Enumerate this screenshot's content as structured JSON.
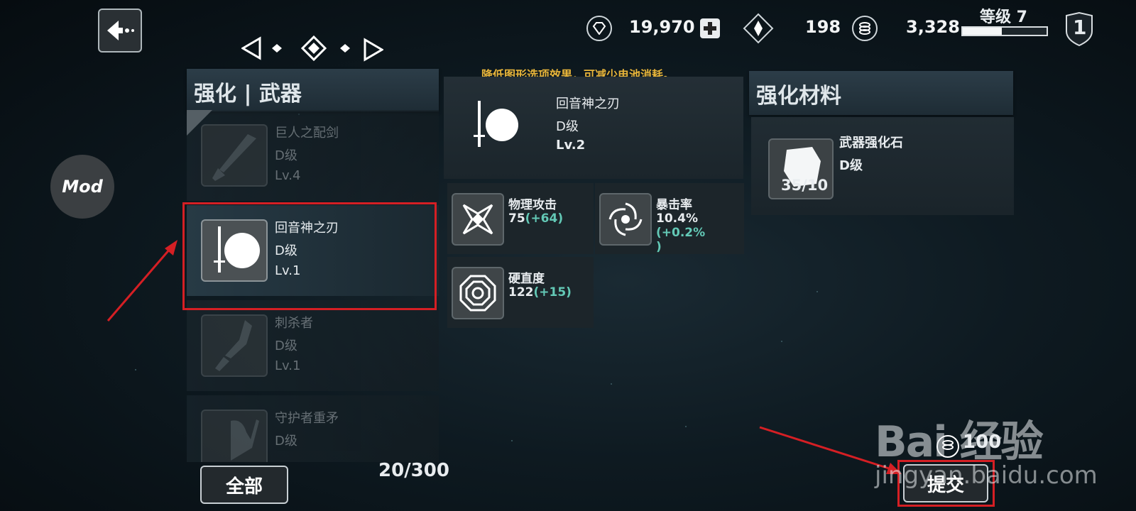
{
  "topbar": {
    "gems": "19,970",
    "shards": "198",
    "coins": "3,328",
    "level_label": "等级 7",
    "level_progress": 0.47,
    "rank_badge": "1"
  },
  "mod_button_label": "Mod",
  "left_panel": {
    "title": "强化 | 武器",
    "items": [
      {
        "name": "巨人之配剑",
        "grade": "D级",
        "level": "Lv.4"
      },
      {
        "name": "回音神之刃",
        "grade": "D级",
        "level": "Lv.1"
      },
      {
        "name": "刺杀者",
        "grade": "D级",
        "level": "Lv.1"
      },
      {
        "name": "守护者重矛",
        "grade": "D级",
        "level": ""
      }
    ],
    "filter_button": "全部",
    "count": "20/300"
  },
  "detail": {
    "warning": "降低图形选项效果，可减少电池消耗。",
    "name": "回音神之刃",
    "grade": "D级",
    "level": "Lv.2",
    "stats": [
      {
        "name": "物理攻击",
        "value": "75",
        "bonus": "(+64)"
      },
      {
        "name": "暴击率",
        "value": "10.4%",
        "bonus": "(+0.2%",
        "bonus_line2": ")"
      },
      {
        "name": "硬直度",
        "value": "122",
        "bonus": "(+15)"
      }
    ]
  },
  "materials": {
    "title": "强化材料",
    "item": {
      "name": "武器强化石",
      "grade": "D级",
      "count": "35/10"
    }
  },
  "submit": {
    "cost": "100",
    "label": "提交"
  },
  "watermark": {
    "line1": "Bai  经验",
    "line2": "jingyan.baidu.com"
  },
  "colors": {
    "bonus": "#63c9b6",
    "warning": "#e8b53a",
    "highlight": "#d51f24"
  }
}
